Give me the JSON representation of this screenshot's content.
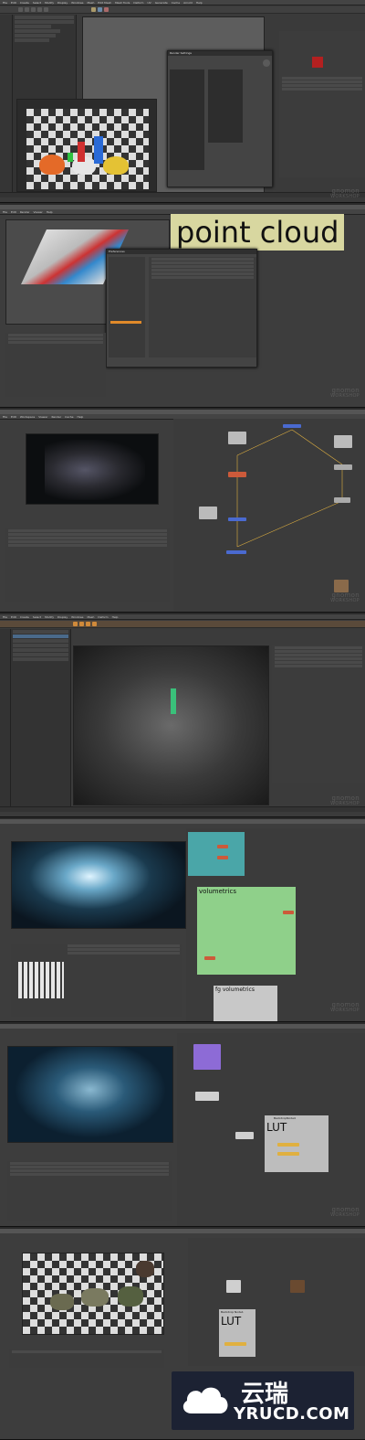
{
  "watermark": {
    "line1": "gnomon",
    "line2": "WORKSHOP"
  },
  "panel1": {
    "menu": [
      "File",
      "Edit",
      "Create",
      "Select",
      "Modify",
      "Display",
      "Windows",
      "Mesh",
      "Edit Mesh",
      "Mesh Tools",
      "Deform",
      "UV",
      "Generate",
      "Cache",
      "Arnold",
      "Help"
    ],
    "dialog_title": "Render Settings"
  },
  "panel2": {
    "banner_text": "point cloud",
    "dialog_title": "Preferences",
    "menu": [
      "File",
      "Edit",
      "Render",
      "Viewer",
      "Help"
    ]
  },
  "panel3": {
    "menu": [
      "File",
      "Edit",
      "Workspace",
      "Viewer",
      "Render",
      "Cache",
      "Help"
    ],
    "graph_title": "Node Graph"
  },
  "panel4": {
    "menu": [
      "File",
      "Edit",
      "Create",
      "Select",
      "Modify",
      "Display",
      "Windows",
      "Mesh",
      "Deform",
      "Help"
    ]
  },
  "panel5": {
    "backdrop1_label": "volumetrics",
    "backdrop2_label": "fg volumetrics"
  },
  "panel6": {
    "backdrop_label": "LUT",
    "backdrop_title": "BackdropNode4"
  },
  "panel7": {
    "backdrop_label": "LUT",
    "backdrop_title": "Backdrop Node1"
  },
  "logo": {
    "name": "云瑞",
    "url": "YRUCD.COM"
  },
  "colors": {
    "accent_orange": "#e08a2a",
    "node_purple": "#8d6bd6",
    "backdrop_green": "#8fd08a",
    "backdrop_teal": "#4aa6a8",
    "banner": "#d8d7a0"
  }
}
